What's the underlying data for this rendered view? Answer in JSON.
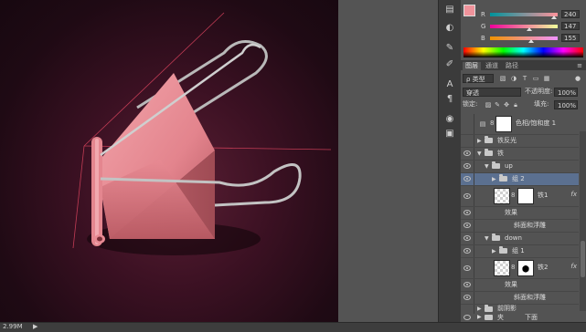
{
  "status": {
    "zoom": "2.99M",
    "arrow": "▶"
  },
  "color_panel": {
    "fg_color": "#f0939b",
    "bg_color": "#ffffff",
    "sliders": [
      {
        "label": "R",
        "value": "240",
        "gradient": "linear-gradient(to right,#00939b,#ff939b)",
        "level": 0.94
      },
      {
        "label": "G",
        "value": "147",
        "gradient": "linear-gradient(to right,#f0009b,#f0ff9b)",
        "level": 0.58
      },
      {
        "label": "B",
        "value": "155",
        "gradient": "linear-gradient(to right,#f09300,#f093ff)",
        "level": 0.61
      }
    ]
  },
  "layers_panel": {
    "tabs": [
      "图层",
      "通道",
      "路径"
    ],
    "kind_filter": "ρ 类型",
    "blend_mode": "穿透",
    "opacity_label": "不透明度:",
    "opacity_value": "100%",
    "lock_label": "锁定:",
    "fill_label": "填充:",
    "fill_value": "100%",
    "layers": [
      {
        "name": "色相/饱和度 1",
        "visible": false
      },
      {
        "name": "铁反光",
        "visible": false
      },
      {
        "name": "铁",
        "visible": true
      },
      {
        "name": "up",
        "visible": true
      },
      {
        "name": "组 2",
        "visible": true
      },
      {
        "name": "铁1",
        "visible": true,
        "fx": "fx"
      },
      {
        "name": "效果",
        "visible": true
      },
      {
        "name": "斜面和浮雕",
        "visible": true
      },
      {
        "name": "down",
        "visible": true
      },
      {
        "name": "组 1",
        "visible": true
      },
      {
        "name": "铁2",
        "visible": true,
        "fx": "fx"
      },
      {
        "name": "效果",
        "visible": true
      },
      {
        "name": "斜面和浮雕",
        "visible": true
      },
      {
        "name": "前阴影",
        "visible": false
      },
      {
        "name": "夹",
        "visible": true
      },
      {
        "name": "下面",
        "visible": true
      }
    ]
  }
}
